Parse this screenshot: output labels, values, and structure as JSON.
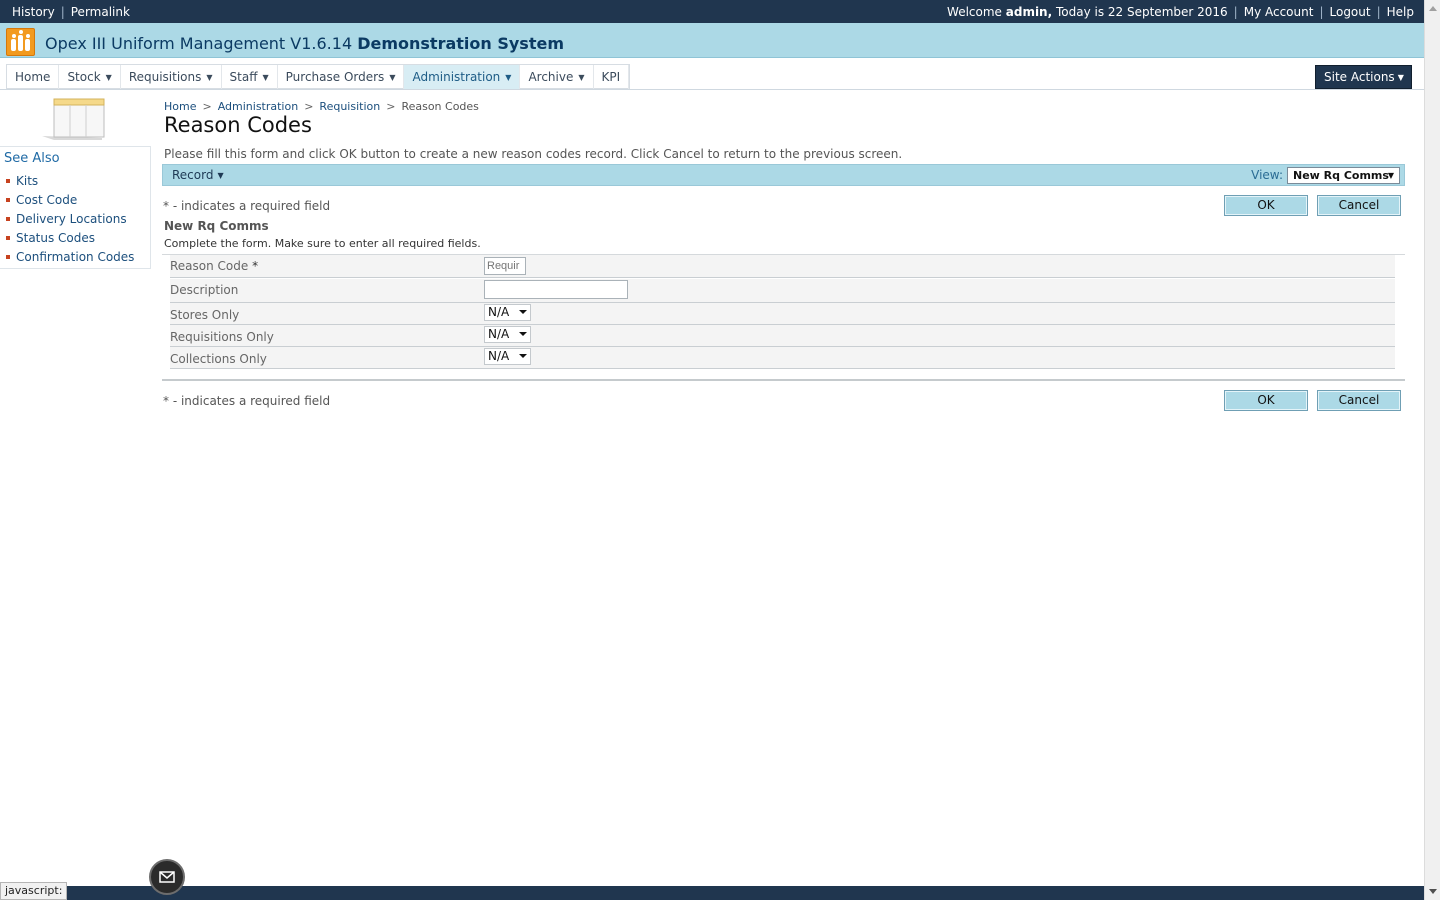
{
  "topbar": {
    "history": "History",
    "permalink": "Permalink",
    "welcome": "Welcome",
    "user": "admin,",
    "today": "Today is 22 September 2016",
    "my_account": "My Account",
    "logout": "Logout",
    "help": "Help"
  },
  "app": {
    "title_prefix": "Opex III Uniform Management V1.6.14",
    "title_suffix": "Demonstration System",
    "logo": "people-group-icon"
  },
  "nav": {
    "tabs": [
      {
        "label": "Home",
        "dropdown": false
      },
      {
        "label": "Stock",
        "dropdown": true
      },
      {
        "label": "Requisitions",
        "dropdown": true
      },
      {
        "label": "Staff",
        "dropdown": true
      },
      {
        "label": "Purchase Orders",
        "dropdown": true
      },
      {
        "label": "Administration",
        "dropdown": true,
        "active": true
      },
      {
        "label": "Archive",
        "dropdown": true
      },
      {
        "label": "KPI",
        "dropdown": false
      }
    ],
    "site_actions": "Site Actions"
  },
  "sidebar": {
    "see_also": "See Also",
    "items": [
      "Kits",
      "Cost Code",
      "Delivery Locations",
      "Status Codes",
      "Confirmation Codes"
    ]
  },
  "breadcrumb": [
    "Home",
    "Administration",
    "Requisition",
    "Reason Codes"
  ],
  "page": {
    "title": "Reason Codes",
    "intro": "Please fill this form and click OK button to create a new reason codes record. Click Cancel to return to the previous screen."
  },
  "toolbar": {
    "record": "Record",
    "view_label": "View:",
    "view_value": "New Rq Comms"
  },
  "form": {
    "required_note": "* - indicates a required field",
    "ok": "OK",
    "cancel": "Cancel",
    "title": "New Rq Comms",
    "subtitle": "Complete the form. Make sure to enter all required fields.",
    "fields": {
      "reason_code": {
        "label": "Reason Code",
        "required_mark": "*",
        "placeholder": "Requir"
      },
      "description": {
        "label": "Description",
        "value": ""
      },
      "stores_only": {
        "label": "Stores Only",
        "value": "N/A"
      },
      "requisitions_only": {
        "label": "Requisitions Only",
        "value": "N/A"
      },
      "collections_only": {
        "label": "Collections Only",
        "value": "N/A"
      }
    }
  },
  "status": {
    "text": "javascript:"
  },
  "colors": {
    "dark_bar": "#20364f",
    "band": "#acd9e6",
    "logo": "#f29a1f"
  }
}
